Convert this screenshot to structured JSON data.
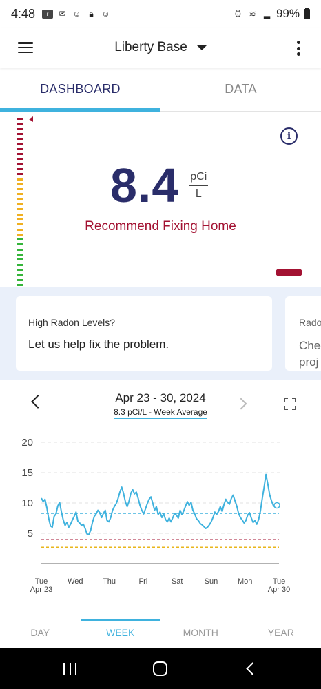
{
  "status_bar": {
    "time": "4:48",
    "left_icons": [
      "ring-icon",
      "gmail-icon",
      "app-icon",
      "lock-icon",
      "app-icon"
    ],
    "right_icons": [
      "alarm-icon",
      "wifi-icon",
      "signal-icon"
    ],
    "battery": "99%"
  },
  "app_bar": {
    "device_name": "Liberty Base"
  },
  "tabs": [
    {
      "label": "DASHBOARD",
      "active": true
    },
    {
      "label": "DATA",
      "active": false
    }
  ],
  "reading": {
    "value": "8.4",
    "unit_top": "pCi",
    "unit_bottom": "L",
    "recommendation": "Recommend Fixing Home",
    "status_color": "#a31232"
  },
  "cards": [
    {
      "title": "High Radon Levels?",
      "body": "Let us help fix the problem."
    },
    {
      "title": "Rado",
      "body_line1": "Chec",
      "body_line2": "proj"
    }
  ],
  "chart_header": {
    "date_range": "Apr 23 - 30, 2024",
    "average": "8.3 pCi/L - Week Average"
  },
  "chart_data": {
    "type": "line",
    "title": "",
    "xlabel": "",
    "ylabel": "",
    "ylim": [
      0,
      20
    ],
    "yticks": [
      5,
      10,
      15,
      20
    ],
    "x_ticks": [
      {
        "day": "Tue",
        "date": "Apr 23"
      },
      {
        "day": "Wed",
        "date": ""
      },
      {
        "day": "Thu",
        "date": ""
      },
      {
        "day": "Fri",
        "date": ""
      },
      {
        "day": "Sat",
        "date": ""
      },
      {
        "day": "Sun",
        "date": ""
      },
      {
        "day": "Mon",
        "date": ""
      },
      {
        "day": "Tue",
        "date": "Apr 30"
      }
    ],
    "series": [
      {
        "color": "#3fb2de",
        "values": [
          10.8,
          10.2,
          10.6,
          9.2,
          7.5,
          6.2,
          6.0,
          7.8,
          8.2,
          9.5,
          10.1,
          8.5,
          7.2,
          6.3,
          6.8,
          6.0,
          6.5,
          7.2,
          7.8,
          8.5,
          7.0,
          6.7,
          6.3,
          6.5,
          5.8,
          4.9,
          4.8,
          5.5,
          6.8,
          7.8,
          8.2,
          8.8,
          8.4,
          7.6,
          8.3,
          8.8,
          7.1,
          6.9,
          7.6,
          8.8,
          9.4,
          9.9,
          10.7,
          11.8,
          12.6,
          11.6,
          10.2,
          9.4,
          10.3,
          11.6,
          12.2,
          11.5,
          11.8,
          10.8,
          9.6,
          8.8,
          8.2,
          9.0,
          9.9,
          10.6,
          11.0,
          10.0,
          8.8,
          9.4,
          8.1,
          8.5,
          7.6,
          8.2,
          7.3,
          6.9,
          7.5,
          6.9,
          7.6,
          8.3,
          8.0,
          7.5,
          8.8,
          8.1,
          8.7,
          9.5,
          10.2,
          9.6,
          10.1,
          8.8,
          8.2,
          7.4,
          7.1,
          6.6,
          6.4,
          6.1,
          5.8,
          6.0,
          6.4,
          6.9,
          7.6,
          8.5,
          8.1,
          8.6,
          9.4,
          8.6,
          9.7,
          10.6,
          10.1,
          9.8,
          10.7,
          11.3,
          10.4,
          9.5,
          8.3,
          7.6,
          7.2,
          6.7,
          7.1,
          8.0,
          8.4,
          7.5,
          6.8,
          7.1,
          6.5,
          7.3,
          8.7,
          10.8,
          12.6,
          14.7,
          13.2,
          11.4,
          10.4,
          9.6,
          9.3,
          9.6
        ]
      }
    ],
    "reference_lines": [
      {
        "value": 8.3,
        "color": "#3fb2de"
      },
      {
        "value": 4.0,
        "color": "#a31232"
      },
      {
        "value": 2.7,
        "color": "#e8b61c"
      }
    ]
  },
  "period_selector": [
    {
      "label": "DAY",
      "active": false
    },
    {
      "label": "WEEK",
      "active": true
    },
    {
      "label": "MONTH",
      "active": false
    },
    {
      "label": "YEAR",
      "active": false
    }
  ]
}
